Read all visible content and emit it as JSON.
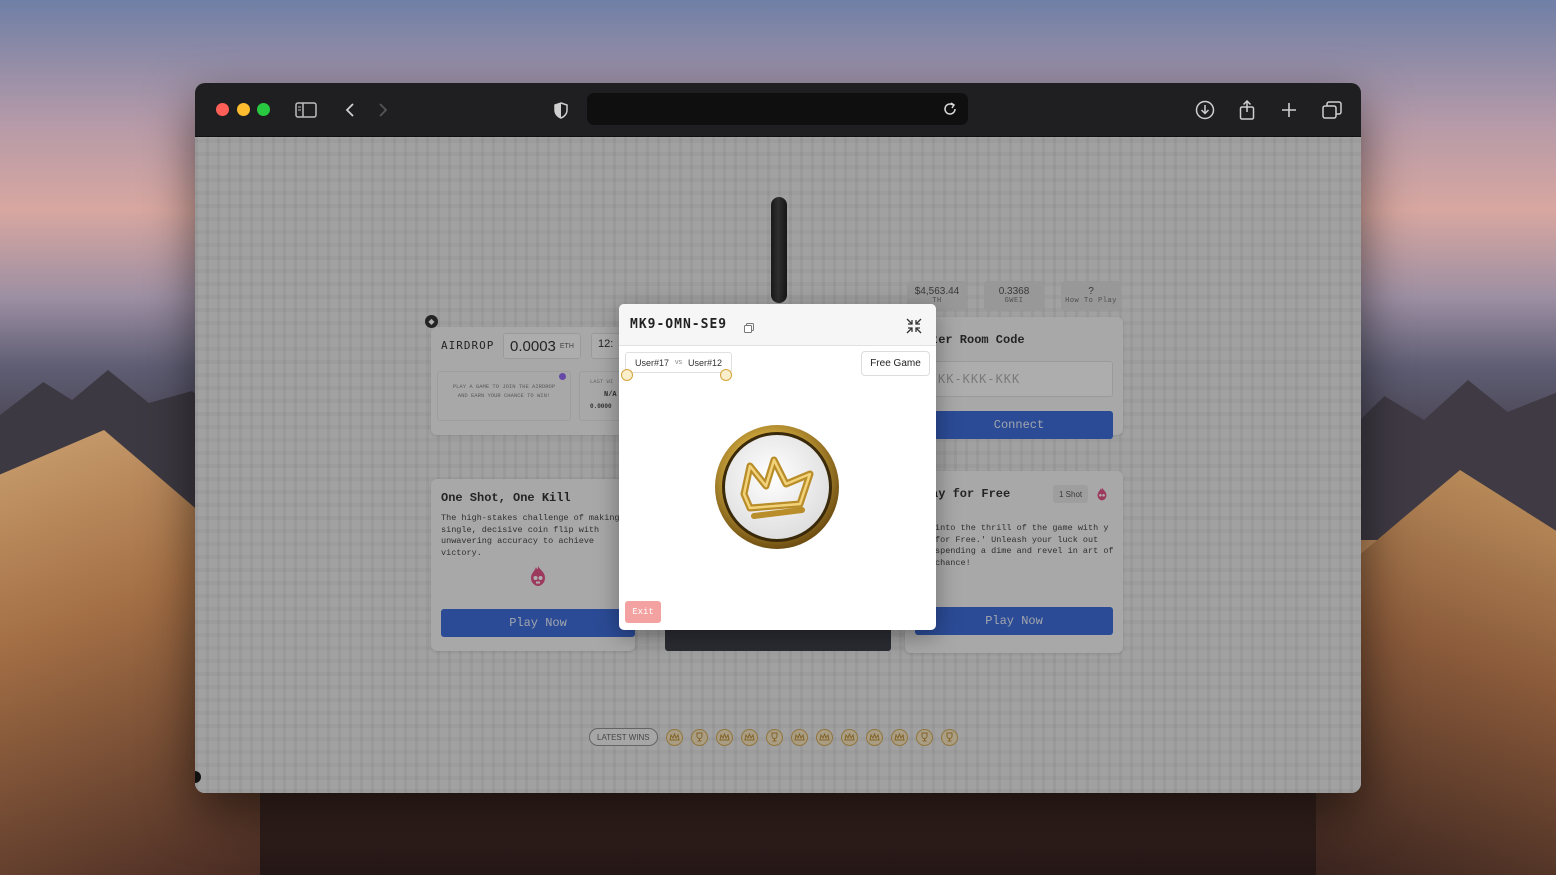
{
  "browser": {
    "url": ""
  },
  "airdrop": {
    "label": "AIRDROP",
    "amount": "0.0003",
    "unit": "ETH",
    "timer_partial": "12:",
    "info_text": "PLAY A GAME TO JOIN THE AIRDROP AND EARN YOUR CHANCE TO WIN!",
    "last_label": "LAST WI",
    "last_value": "N/A",
    "last_amount": "0.0000"
  },
  "stats": [
    {
      "value": "$4,563.44",
      "label": "TH"
    },
    {
      "value": "0.3368",
      "label": "GWEI"
    },
    {
      "value": "?",
      "label": "How To Play"
    }
  ],
  "room": {
    "title": "ter Room Code",
    "input_placeholder": "KK-KKK-KKK",
    "connect_label": "Connect"
  },
  "one_shot": {
    "title": "One Shot, One Kill",
    "description": "The high-stakes challenge of making single, decisive coin flip with unwavering accuracy to achieve victory.",
    "play_label": "Play Now"
  },
  "free_play": {
    "title": "ay for Free",
    "badge": "1 Shot",
    "description": "into the thrill of the game with y for Free.' Unleash your luck out spending a dime and revel in art of chance!",
    "play_label": "Play Now"
  },
  "modal": {
    "room_code": "MK9-OMN-SE9",
    "player1": "User#17",
    "vs": "vs",
    "player2": "User#12",
    "game_type": "Free Game",
    "exit_label": "Exit"
  },
  "latest_wins": {
    "label": "LATEST WINS",
    "results": [
      "crown",
      "trophy",
      "crown",
      "crown",
      "trophy",
      "crown",
      "crown",
      "crown",
      "crown",
      "crown",
      "trophy",
      "trophy"
    ]
  },
  "colors": {
    "primary_button": "#2d5fd6",
    "exit_button": "#f4a1a1",
    "coin_gold": "#c9a23a"
  }
}
